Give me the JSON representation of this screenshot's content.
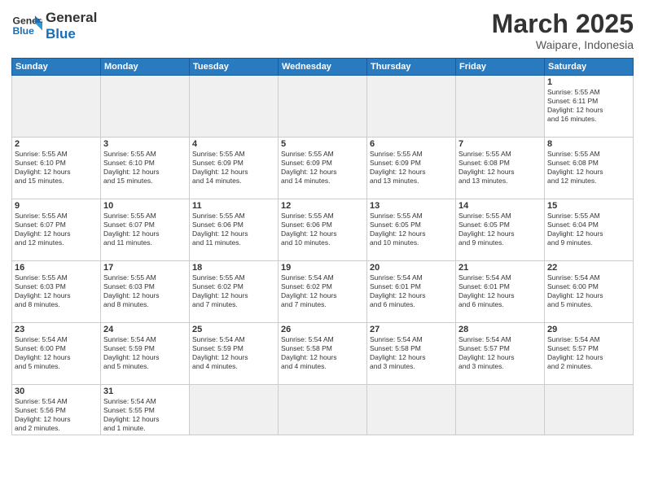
{
  "logo": {
    "text_general": "General",
    "text_blue": "Blue"
  },
  "header": {
    "month": "March 2025",
    "location": "Waipare, Indonesia"
  },
  "weekdays": [
    "Sunday",
    "Monday",
    "Tuesday",
    "Wednesday",
    "Thursday",
    "Friday",
    "Saturday"
  ],
  "days": [
    {
      "num": "",
      "info": ""
    },
    {
      "num": "",
      "info": ""
    },
    {
      "num": "",
      "info": ""
    },
    {
      "num": "",
      "info": ""
    },
    {
      "num": "",
      "info": ""
    },
    {
      "num": "",
      "info": ""
    },
    {
      "num": "1",
      "info": "Sunrise: 5:55 AM\nSunset: 6:11 PM\nDaylight: 12 hours\nand 16 minutes."
    },
    {
      "num": "2",
      "info": "Sunrise: 5:55 AM\nSunset: 6:10 PM\nDaylight: 12 hours\nand 15 minutes."
    },
    {
      "num": "3",
      "info": "Sunrise: 5:55 AM\nSunset: 6:10 PM\nDaylight: 12 hours\nand 15 minutes."
    },
    {
      "num": "4",
      "info": "Sunrise: 5:55 AM\nSunset: 6:09 PM\nDaylight: 12 hours\nand 14 minutes."
    },
    {
      "num": "5",
      "info": "Sunrise: 5:55 AM\nSunset: 6:09 PM\nDaylight: 12 hours\nand 14 minutes."
    },
    {
      "num": "6",
      "info": "Sunrise: 5:55 AM\nSunset: 6:09 PM\nDaylight: 12 hours\nand 13 minutes."
    },
    {
      "num": "7",
      "info": "Sunrise: 5:55 AM\nSunset: 6:08 PM\nDaylight: 12 hours\nand 13 minutes."
    },
    {
      "num": "8",
      "info": "Sunrise: 5:55 AM\nSunset: 6:08 PM\nDaylight: 12 hours\nand 12 minutes."
    },
    {
      "num": "9",
      "info": "Sunrise: 5:55 AM\nSunset: 6:07 PM\nDaylight: 12 hours\nand 12 minutes."
    },
    {
      "num": "10",
      "info": "Sunrise: 5:55 AM\nSunset: 6:07 PM\nDaylight: 12 hours\nand 11 minutes."
    },
    {
      "num": "11",
      "info": "Sunrise: 5:55 AM\nSunset: 6:06 PM\nDaylight: 12 hours\nand 11 minutes."
    },
    {
      "num": "12",
      "info": "Sunrise: 5:55 AM\nSunset: 6:06 PM\nDaylight: 12 hours\nand 10 minutes."
    },
    {
      "num": "13",
      "info": "Sunrise: 5:55 AM\nSunset: 6:05 PM\nDaylight: 12 hours\nand 10 minutes."
    },
    {
      "num": "14",
      "info": "Sunrise: 5:55 AM\nSunset: 6:05 PM\nDaylight: 12 hours\nand 9 minutes."
    },
    {
      "num": "15",
      "info": "Sunrise: 5:55 AM\nSunset: 6:04 PM\nDaylight: 12 hours\nand 9 minutes."
    },
    {
      "num": "16",
      "info": "Sunrise: 5:55 AM\nSunset: 6:03 PM\nDaylight: 12 hours\nand 8 minutes."
    },
    {
      "num": "17",
      "info": "Sunrise: 5:55 AM\nSunset: 6:03 PM\nDaylight: 12 hours\nand 8 minutes."
    },
    {
      "num": "18",
      "info": "Sunrise: 5:55 AM\nSunset: 6:02 PM\nDaylight: 12 hours\nand 7 minutes."
    },
    {
      "num": "19",
      "info": "Sunrise: 5:54 AM\nSunset: 6:02 PM\nDaylight: 12 hours\nand 7 minutes."
    },
    {
      "num": "20",
      "info": "Sunrise: 5:54 AM\nSunset: 6:01 PM\nDaylight: 12 hours\nand 6 minutes."
    },
    {
      "num": "21",
      "info": "Sunrise: 5:54 AM\nSunset: 6:01 PM\nDaylight: 12 hours\nand 6 minutes."
    },
    {
      "num": "22",
      "info": "Sunrise: 5:54 AM\nSunset: 6:00 PM\nDaylight: 12 hours\nand 5 minutes."
    },
    {
      "num": "23",
      "info": "Sunrise: 5:54 AM\nSunset: 6:00 PM\nDaylight: 12 hours\nand 5 minutes."
    },
    {
      "num": "24",
      "info": "Sunrise: 5:54 AM\nSunset: 5:59 PM\nDaylight: 12 hours\nand 5 minutes."
    },
    {
      "num": "25",
      "info": "Sunrise: 5:54 AM\nSunset: 5:59 PM\nDaylight: 12 hours\nand 4 minutes."
    },
    {
      "num": "26",
      "info": "Sunrise: 5:54 AM\nSunset: 5:58 PM\nDaylight: 12 hours\nand 4 minutes."
    },
    {
      "num": "27",
      "info": "Sunrise: 5:54 AM\nSunset: 5:58 PM\nDaylight: 12 hours\nand 3 minutes."
    },
    {
      "num": "28",
      "info": "Sunrise: 5:54 AM\nSunset: 5:57 PM\nDaylight: 12 hours\nand 3 minutes."
    },
    {
      "num": "29",
      "info": "Sunrise: 5:54 AM\nSunset: 5:57 PM\nDaylight: 12 hours\nand 2 minutes."
    },
    {
      "num": "30",
      "info": "Sunrise: 5:54 AM\nSunset: 5:56 PM\nDaylight: 12 hours\nand 2 minutes."
    },
    {
      "num": "31",
      "info": "Sunrise: 5:54 AM\nSunset: 5:55 PM\nDaylight: 12 hours\nand 1 minute."
    }
  ]
}
